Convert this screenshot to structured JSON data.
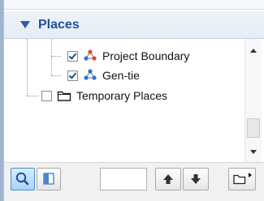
{
  "panel": {
    "section_title": "Places"
  },
  "tree": {
    "items": [
      {
        "label": "Project Boundary",
        "checked": true,
        "icon": "polygon-layer-icon"
      },
      {
        "label": "Gen-tie",
        "checked": true,
        "icon": "polygon-layer-icon"
      },
      {
        "label": "Temporary Places",
        "checked": false,
        "icon": "folder-icon"
      }
    ]
  },
  "toolbar": {
    "search_value": "",
    "buttons": [
      "search-icon",
      "layer-view-icon",
      "move-up-icon",
      "move-down-icon",
      "folder-menu-icon"
    ]
  },
  "colors": {
    "header_text": "#1f4f97",
    "active_button": "#a9d3f7",
    "icon_red": "#e24a2b",
    "icon_blue": "#2a74d6"
  }
}
